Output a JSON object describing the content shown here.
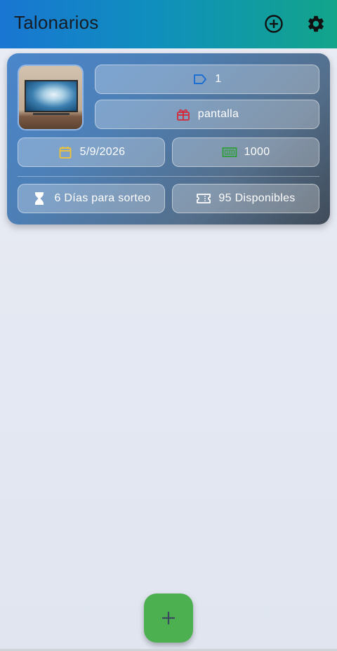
{
  "appbar": {
    "title": "Talonarios",
    "add_icon": "add-circle-outline-icon",
    "settings_icon": "gear-icon"
  },
  "talonario": {
    "id_value": "1",
    "prize": "pantalla",
    "date": "5/9/2026",
    "price": "1000",
    "days_text": "6 Días para sorteo",
    "available_text": "95 Disponibles",
    "image": "tv-screen-photo"
  },
  "colors": {
    "appbar_start": "#1976d2",
    "appbar_end": "#12a58a",
    "tag_icon": "#1e6fd1",
    "gift_icon": "#d62839",
    "calendar_icon": "#f4c430",
    "money_icon": "#2e9e3a",
    "fab": "#4caf50"
  },
  "fab": {
    "icon": "plus-icon"
  }
}
